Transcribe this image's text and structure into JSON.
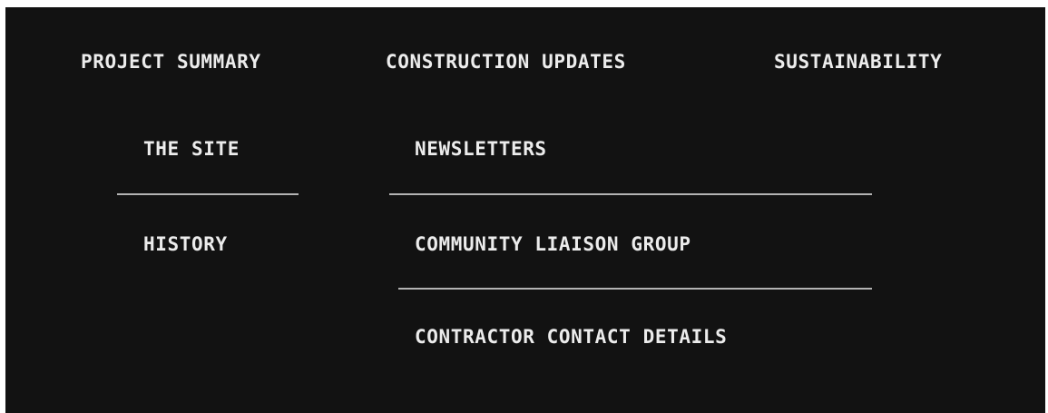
{
  "nav": {
    "top_items": [
      {
        "label": "PROJECT SUMMARY"
      },
      {
        "label": "CONSTRUCTION UPDATES"
      },
      {
        "label": "SUSTAINABILITY"
      }
    ],
    "project_summary_submenu": [
      {
        "label": "THE SITE"
      },
      {
        "label": "HISTORY"
      }
    ],
    "construction_updates_submenu": [
      {
        "label": "NEWSLETTERS"
      },
      {
        "label": "COMMUNITY LIAISON GROUP"
      },
      {
        "label": "CONTRACTOR CONTACT DETAILS"
      }
    ]
  },
  "colors": {
    "background": "#121212",
    "text": "#ececec",
    "divider": "#b3b3b3"
  }
}
